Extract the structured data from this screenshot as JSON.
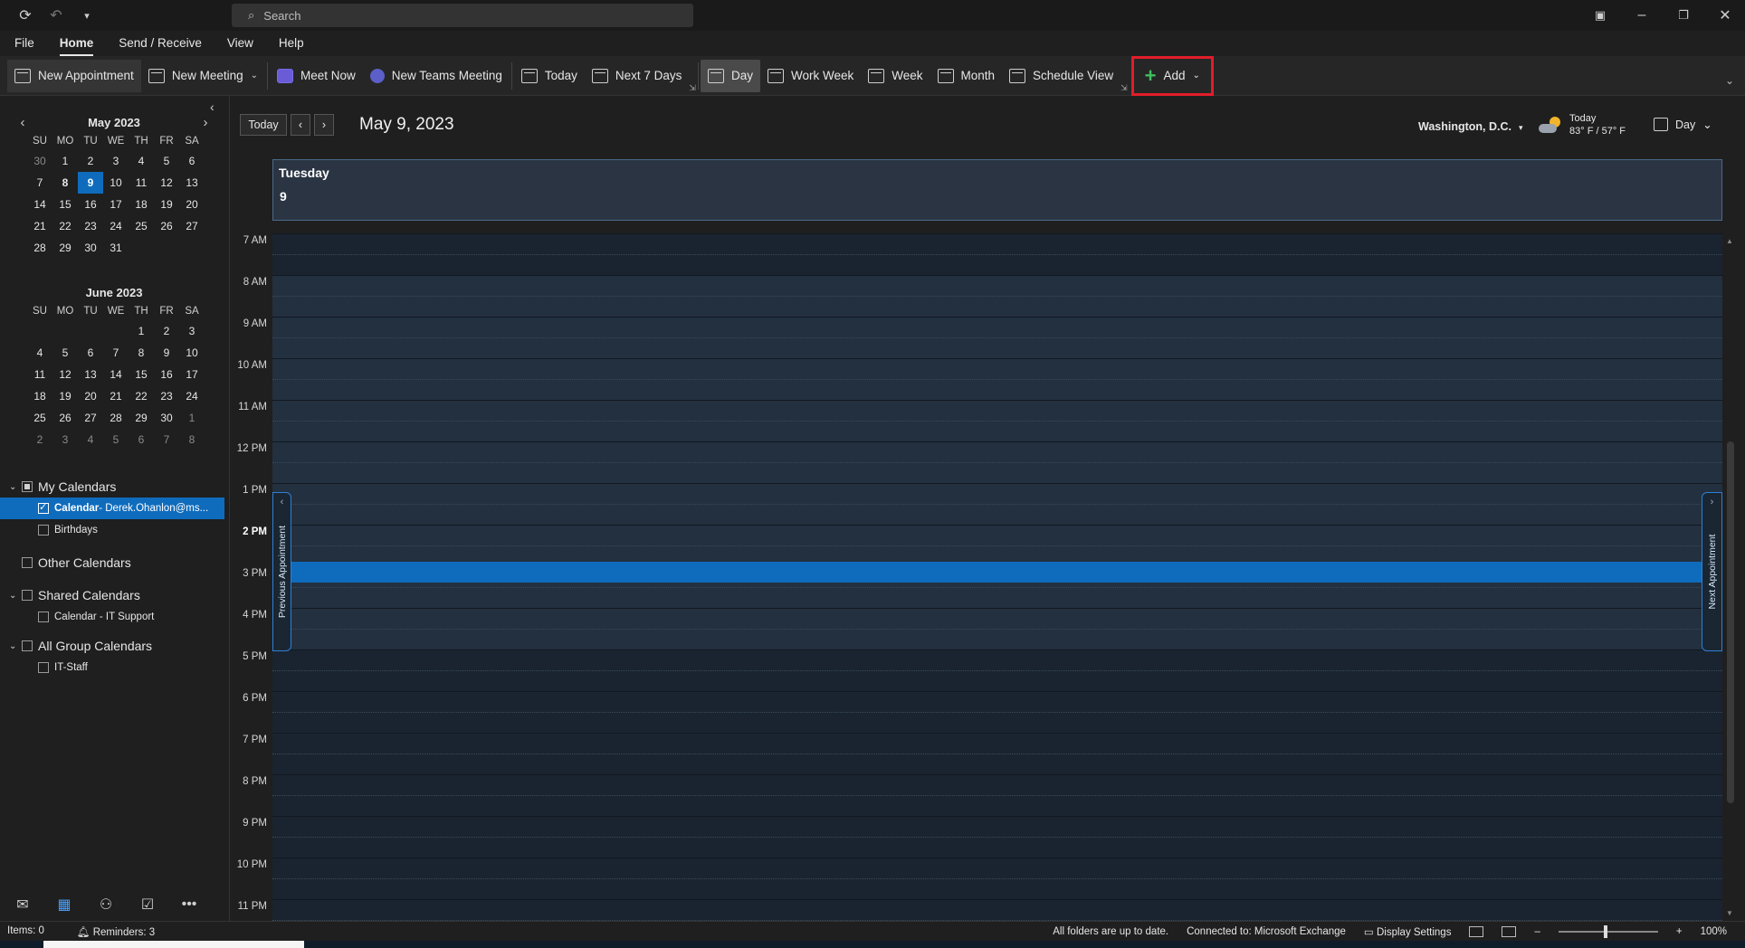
{
  "titlebar": {
    "search_placeholder": "Search"
  },
  "menu": {
    "tabs": [
      "File",
      "Home",
      "Send / Receive",
      "View",
      "Help"
    ],
    "active": "Home"
  },
  "ribbon": {
    "new_appointment": "New Appointment",
    "new_meeting": "New Meeting",
    "meet_now": "Meet Now",
    "new_teams_meeting": "New Teams Meeting",
    "today": "Today",
    "next_7_days": "Next 7 Days",
    "day": "Day",
    "work_week": "Work Week",
    "week": "Week",
    "month": "Month",
    "schedule_view": "Schedule View",
    "add": "Add"
  },
  "mini_calendars": [
    {
      "title": "May 2023",
      "dow": [
        "SU",
        "MO",
        "TU",
        "WE",
        "TH",
        "FR",
        "SA"
      ],
      "weeks": [
        [
          "30",
          "1",
          "2",
          "3",
          "4",
          "5",
          "6"
        ],
        [
          "7",
          "8",
          "9",
          "10",
          "11",
          "12",
          "13"
        ],
        [
          "14",
          "15",
          "16",
          "17",
          "18",
          "19",
          "20"
        ],
        [
          "21",
          "22",
          "23",
          "24",
          "25",
          "26",
          "27"
        ],
        [
          "28",
          "29",
          "30",
          "31",
          "",
          "",
          ""
        ]
      ]
    },
    {
      "title": "June 2023",
      "dow": [
        "SU",
        "MO",
        "TU",
        "WE",
        "TH",
        "FR",
        "SA"
      ],
      "weeks": [
        [
          "",
          "",
          "",
          "",
          "1",
          "2",
          "3"
        ],
        [
          "4",
          "5",
          "6",
          "7",
          "8",
          "9",
          "10"
        ],
        [
          "11",
          "12",
          "13",
          "14",
          "15",
          "16",
          "17"
        ],
        [
          "18",
          "19",
          "20",
          "21",
          "22",
          "23",
          "24"
        ],
        [
          "25",
          "26",
          "27",
          "28",
          "29",
          "30",
          "1"
        ],
        [
          "2",
          "3",
          "4",
          "5",
          "6",
          "7",
          "8"
        ]
      ]
    }
  ],
  "calendar_groups": {
    "my_calendars": "My Calendars",
    "calendar_selected_bold": "Calendar",
    "calendar_selected_rest": " - Derek.Ohanlon@ms...",
    "birthdays": "Birthdays",
    "other_calendars": "Other Calendars",
    "shared_calendars": "Shared Calendars",
    "shared_item": "Calendar - IT Support",
    "all_group_calendars": "All Group Calendars",
    "group_item": "IT-Staff"
  },
  "main": {
    "today_btn": "Today",
    "date_title": "May 9, 2023",
    "location": "Washington, D.C.",
    "weather_label": "Today",
    "weather_temp": "83° F / 57° F",
    "view_label": "Day",
    "day_name": "Tuesday",
    "day_number": "9",
    "times": [
      "7 AM",
      "8 AM",
      "9 AM",
      "10 AM",
      "11 AM",
      "12 PM",
      "1 PM",
      "2 PM",
      "3 PM",
      "4 PM",
      "5 PM",
      "6 PM",
      "7 PM",
      "8 PM",
      "9 PM",
      "10 PM",
      "11 PM"
    ],
    "previous_appointment": "Previous Appointment",
    "next_appointment": "Next Appointment"
  },
  "statusbar": {
    "items": "Items: 0",
    "reminders": "Reminders: 3",
    "sync": "All folders are up to date.",
    "connection": "Connected to: Microsoft Exchange",
    "display_settings": "Display Settings",
    "zoom": "100%"
  },
  "colors": {
    "accent": "#0f6cbd",
    "highlight_border": "#e11d2a"
  }
}
